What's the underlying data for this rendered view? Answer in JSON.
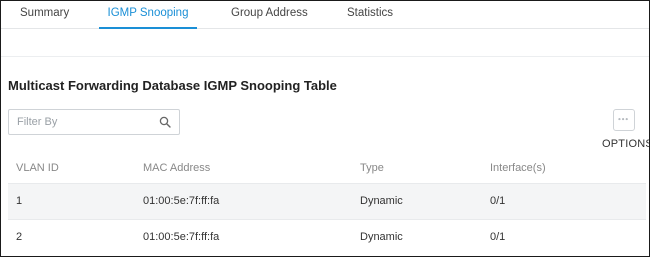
{
  "tabs": [
    {
      "label": "Summary",
      "active": false
    },
    {
      "label": "IGMP Snooping",
      "active": true
    },
    {
      "label": "Group Address",
      "active": false
    },
    {
      "label": "Statistics",
      "active": false
    }
  ],
  "section": {
    "title": "Multicast Forwarding Database IGMP Snooping Table"
  },
  "filter": {
    "placeholder": "Filter By",
    "value": "",
    "icon": "search-icon"
  },
  "options": {
    "label": "OPTIONS",
    "icon": "more-dots-icon"
  },
  "table": {
    "columns": [
      "VLAN ID",
      "MAC Address",
      "Type",
      "Interface(s)"
    ],
    "rows": [
      [
        "1",
        "01:00:5e:7f:ff:fa",
        "Dynamic",
        "0/1"
      ],
      [
        "2",
        "01:00:5e:7f:ff:fa",
        "Dynamic",
        "0/1"
      ]
    ]
  },
  "colors": {
    "accent": "#1a8fd6",
    "row_alt": "#f4f5f6",
    "border": "#cfd3d7"
  }
}
